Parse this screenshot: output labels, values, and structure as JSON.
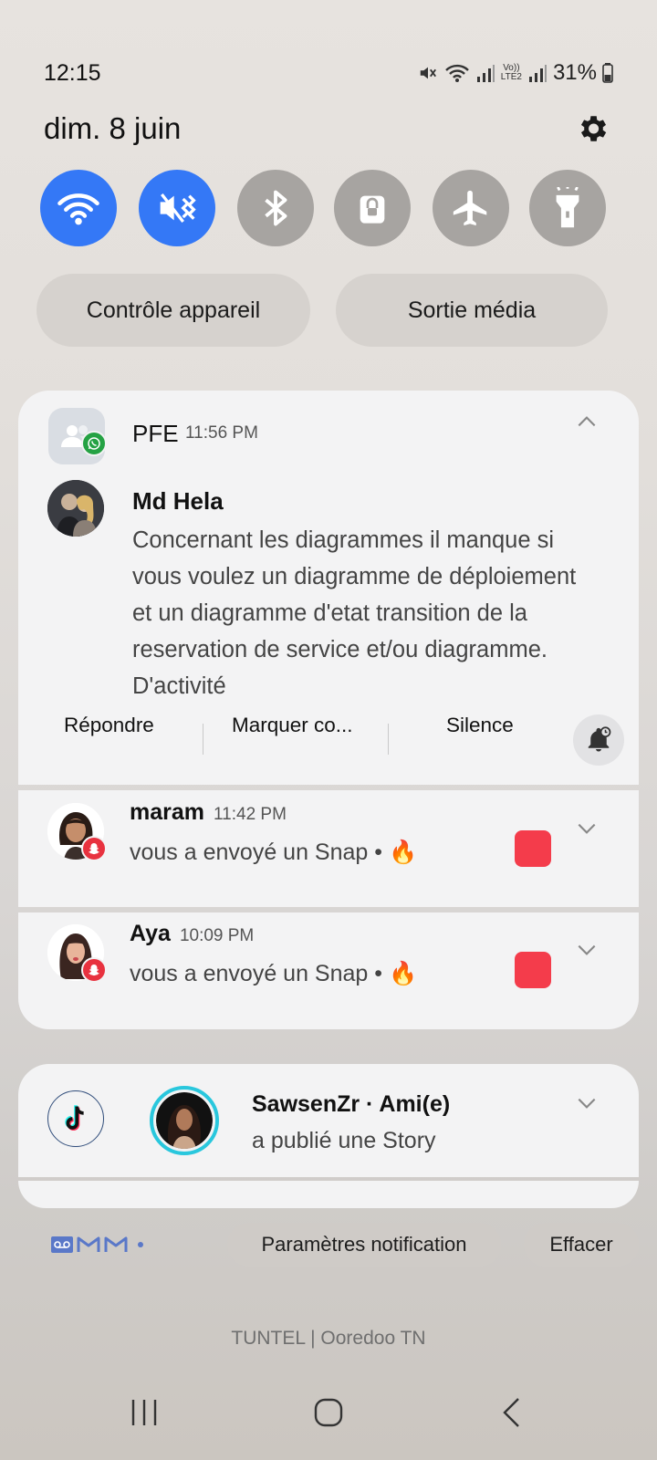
{
  "status_bar": {
    "time": "12:15",
    "lte_label": "LTE2",
    "volte_label": "Vo))",
    "battery": "31%",
    "icons": [
      "mute-icon",
      "wifi-icon",
      "signal-icon",
      "volte-icon",
      "signal-icon",
      "battery-icon"
    ]
  },
  "header": {
    "date": "dim. 8 juin"
  },
  "quick_toggles": [
    {
      "name": "wifi",
      "state": "on",
      "icon": "wifi-icon"
    },
    {
      "name": "sound",
      "state": "on",
      "icon": "mute-vibrate-icon"
    },
    {
      "name": "bluetooth",
      "state": "off",
      "icon": "bluetooth-icon"
    },
    {
      "name": "screen-lock",
      "state": "off",
      "icon": "lock-icon"
    },
    {
      "name": "airplane",
      "state": "off",
      "icon": "airplane-icon"
    },
    {
      "name": "flashlight",
      "state": "off",
      "icon": "flashlight-icon"
    }
  ],
  "pills": {
    "device_control": "Contrôle appareil",
    "media_output": "Sortie média"
  },
  "notifications": {
    "pfe": {
      "group_title": "PFE",
      "time": "11:56 PM",
      "sender": "Md Hela",
      "message": "Concernant les diagrammes il manque si vous voulez un diagramme de déploiement et un diagramme d'etat transition de la reservation de service et/ou diagramme. D'activité",
      "actions": {
        "reply": "Répondre",
        "mark": "Marquer co...",
        "silence": "Silence"
      }
    },
    "maram": {
      "name": "maram",
      "time": "11:42 PM",
      "text": "vous a envoyé un Snap • 🔥"
    },
    "aya": {
      "name": "Aya",
      "time": "10:09 PM",
      "text": "vous a envoyé un Snap • 🔥"
    },
    "tiktok": {
      "title": "SawsenZr · Ami(e)",
      "text": "a publié une Story"
    }
  },
  "footer": {
    "settings": "Paramètres notification",
    "clear": "Effacer",
    "carrier": "TUNTEL | Ooredoo TN"
  },
  "colors": {
    "accent": "#3478f6",
    "snap_red": "#f43c4b",
    "whatsapp": "#25a244",
    "tiktok_ring": "#29c7dd"
  }
}
